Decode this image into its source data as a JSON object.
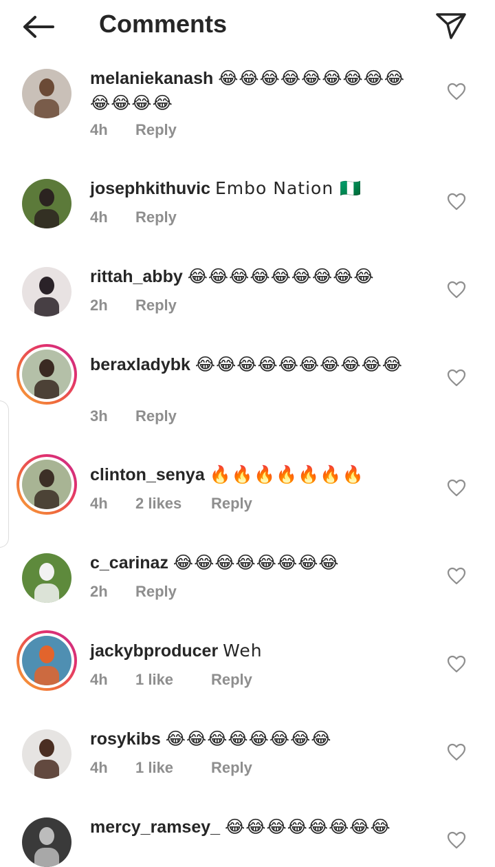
{
  "header": {
    "title": "Comments",
    "back_icon": "arrow-left-icon",
    "send_icon": "paper-plane-icon"
  },
  "comments": [
    {
      "username": "melaniekanash",
      "text": "😂😂😂😂😂😂😂😂😂😂😂😂😂",
      "time": "4h",
      "likes": "",
      "reply": "Reply",
      "ring": false,
      "avatar_bg": "#c9c0b8",
      "avatar_fg": "#6b4a36"
    },
    {
      "username": "josephkithuvic",
      "text": "Embo Nation 🇳🇬",
      "time": "4h",
      "likes": "",
      "reply": "Reply",
      "ring": false,
      "avatar_bg": "#5c7a3a",
      "avatar_fg": "#2b2320"
    },
    {
      "username": "rittah_abby",
      "text": "😂😂😂😂😂😂😂😂😂",
      "time": "2h",
      "likes": "",
      "reply": "Reply",
      "ring": false,
      "avatar_bg": "#e8e2e2",
      "avatar_fg": "#2a2228"
    },
    {
      "username": "beraxladybk",
      "text": "😂😂😂😂😂😂😂😂😂😂",
      "time": "3h",
      "likes": "",
      "reply": "Reply",
      "ring": true,
      "avatar_bg": "#b4c0a8",
      "avatar_fg": "#3a2a22"
    },
    {
      "username": "clinton_senya",
      "text": "🔥🔥🔥🔥🔥🔥🔥",
      "time": "4h",
      "likes": "2 likes",
      "reply": "Reply",
      "ring": true,
      "avatar_bg": "#a8b494",
      "avatar_fg": "#3c2f26"
    },
    {
      "username": "c_carinaz",
      "text": "😂😂😂😂😂😂😂😂",
      "time": "2h",
      "likes": "",
      "reply": "Reply",
      "ring": false,
      "avatar_bg": "#5e8a3c",
      "avatar_fg": "#f2f2f2"
    },
    {
      "username": "jackybproducer",
      "text": "Weh",
      "time": "4h",
      "likes": "1 like",
      "reply": "Reply",
      "ring": true,
      "avatar_bg": "#4f8fb2",
      "avatar_fg": "#e2642c"
    },
    {
      "username": "rosykibs",
      "text": "😂😂😂😂😂😂😂😂",
      "time": "4h",
      "likes": "1 like",
      "reply": "Reply",
      "ring": false,
      "avatar_bg": "#e6e4e2",
      "avatar_fg": "#4a2e22"
    },
    {
      "username": "mercy_ramsey_",
      "text": "😂😂😂😂😂😂😂😂",
      "time": "",
      "likes": "",
      "reply": "",
      "ring": false,
      "avatar_bg": "#3a3a3a",
      "avatar_fg": "#bcbcbc"
    }
  ]
}
